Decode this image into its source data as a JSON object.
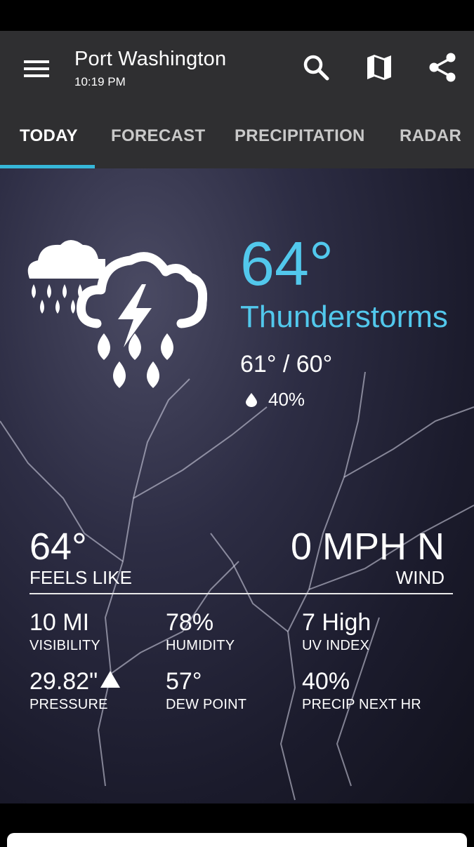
{
  "header": {
    "city": "Port Washington",
    "time": "10:19 PM",
    "icons": [
      "menu-icon",
      "search-icon",
      "map-icon",
      "share-icon"
    ]
  },
  "tabs": [
    {
      "label": "TODAY",
      "active": true
    },
    {
      "label": "FORECAST",
      "active": false
    },
    {
      "label": "PRECIPITATION",
      "active": false
    },
    {
      "label": "RADAR",
      "active": false
    }
  ],
  "current": {
    "temperature": "64°",
    "condition": "Thunderstorms",
    "hi_lo": "61° / 60°",
    "precip_chance": "40%",
    "icon": "thunderstorm-rain-icon"
  },
  "details": {
    "feels_like_value": "64°",
    "feels_like_label": "FEELS LIKE",
    "wind_value": "0 MPH N",
    "wind_label": "WIND",
    "stats": [
      {
        "value": "10 MI",
        "label": "VISIBILITY"
      },
      {
        "value": "78%",
        "label": "HUMIDITY"
      },
      {
        "value": "7 High",
        "label": "UV INDEX"
      },
      {
        "value": "29.82\"",
        "label": "PRESSURE"
      },
      {
        "value": "57°",
        "label": "DEW POINT"
      },
      {
        "value": "40%",
        "label": "PRECIP NEXT HR"
      }
    ]
  },
  "colors": {
    "accent": "#52c8ec",
    "tab_indicator": "#36b7d9",
    "app_bar": "#2f2f31"
  }
}
